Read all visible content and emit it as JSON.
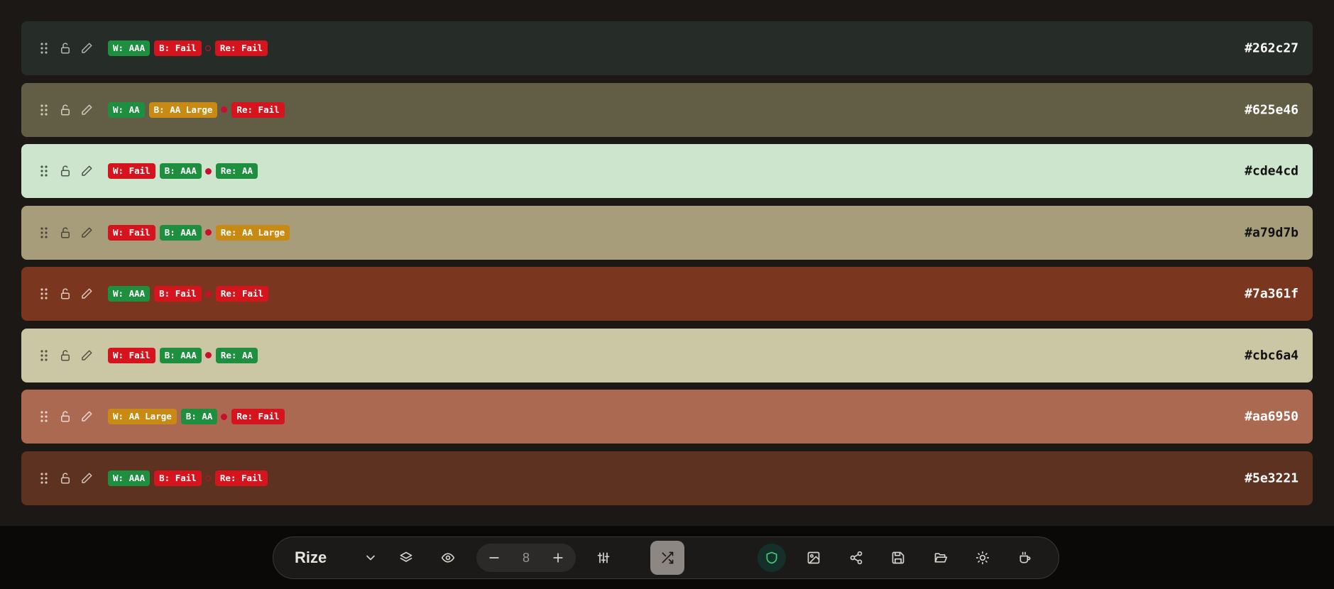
{
  "palette": [
    {
      "hex": "#262c27",
      "bg": "#262c27",
      "text": "#ffffff",
      "icon": "#b0b5b1",
      "w": {
        "label": "W: AAA",
        "color": "#1e8f3f"
      },
      "b": {
        "label": "B: Fail",
        "color": "#d6141d"
      },
      "dot": "hollow",
      "re": {
        "label": "Re: Fail",
        "color": "#d6141d"
      }
    },
    {
      "hex": "#625e46",
      "bg": "#625e46",
      "text": "#ffffff",
      "icon": "#d0ccc0",
      "w": {
        "label": "W: AA",
        "color": "#1e8f3f"
      },
      "b": {
        "label": "B: AA Large",
        "color": "#c98a14"
      },
      "dot": "solid",
      "re": {
        "label": "Re: Fail",
        "color": "#d6141d"
      }
    },
    {
      "hex": "#cde4cd",
      "bg": "#cde4cd",
      "text": "#111111",
      "icon": "#4a524a",
      "w": {
        "label": "W: Fail",
        "color": "#d6141d"
      },
      "b": {
        "label": "B: AAA",
        "color": "#1e8f3f"
      },
      "dot": "solid",
      "re": {
        "label": "Re: AA",
        "color": "#1e8f3f"
      }
    },
    {
      "hex": "#a79d7b",
      "bg": "#a79d7b",
      "text": "#111111",
      "icon": "#4a4636",
      "w": {
        "label": "W: Fail",
        "color": "#d6141d"
      },
      "b": {
        "label": "B: AAA",
        "color": "#1e8f3f"
      },
      "dot": "solid",
      "re": {
        "label": "Re: AA Large",
        "color": "#c98a14"
      }
    },
    {
      "hex": "#7a361f",
      "bg": "#7a361f",
      "text": "#ffffff",
      "icon": "#e0c8bf",
      "w": {
        "label": "W: AAA",
        "color": "#1e8f3f"
      },
      "b": {
        "label": "B: Fail",
        "color": "#d6141d"
      },
      "dot": "solid",
      "re": {
        "label": "Re: Fail",
        "color": "#d6141d"
      }
    },
    {
      "hex": "#cbc6a4",
      "bg": "#cbc6a4",
      "text": "#111111",
      "icon": "#545141",
      "w": {
        "label": "W: Fail",
        "color": "#d6141d"
      },
      "b": {
        "label": "B: AAA",
        "color": "#1e8f3f"
      },
      "dot": "solid",
      "re": {
        "label": "Re: AA",
        "color": "#1e8f3f"
      }
    },
    {
      "hex": "#aa6950",
      "bg": "#aa6950",
      "text": "#ffffff",
      "icon": "#eed8cf",
      "w": {
        "label": "W: AA Large",
        "color": "#c98a14"
      },
      "b": {
        "label": "B: AA",
        "color": "#1e8f3f"
      },
      "dot": "solid",
      "re": {
        "label": "Re: Fail",
        "color": "#d6141d"
      }
    },
    {
      "hex": "#5e3221",
      "bg": "#5e3221",
      "text": "#ffffff",
      "icon": "#d8c4bb",
      "w": {
        "label": "W: AAA",
        "color": "#1e8f3f"
      },
      "b": {
        "label": "B: Fail",
        "color": "#d6141d"
      },
      "dot": "hollow",
      "re": {
        "label": "Re: Fail",
        "color": "#d6141d"
      }
    }
  ],
  "toolbar": {
    "brand": "Rize",
    "count": "8",
    "icons": [
      "chevron-down-icon",
      "layers-icon",
      "eye-icon",
      "minus-icon",
      "plus-icon",
      "sliders-icon",
      "shuffle-icon",
      "shield-icon",
      "image-icon",
      "share-icon",
      "save-icon",
      "folder-open-icon",
      "sun-icon",
      "coffee-icon"
    ],
    "accent_color": "#3ecf7a"
  }
}
